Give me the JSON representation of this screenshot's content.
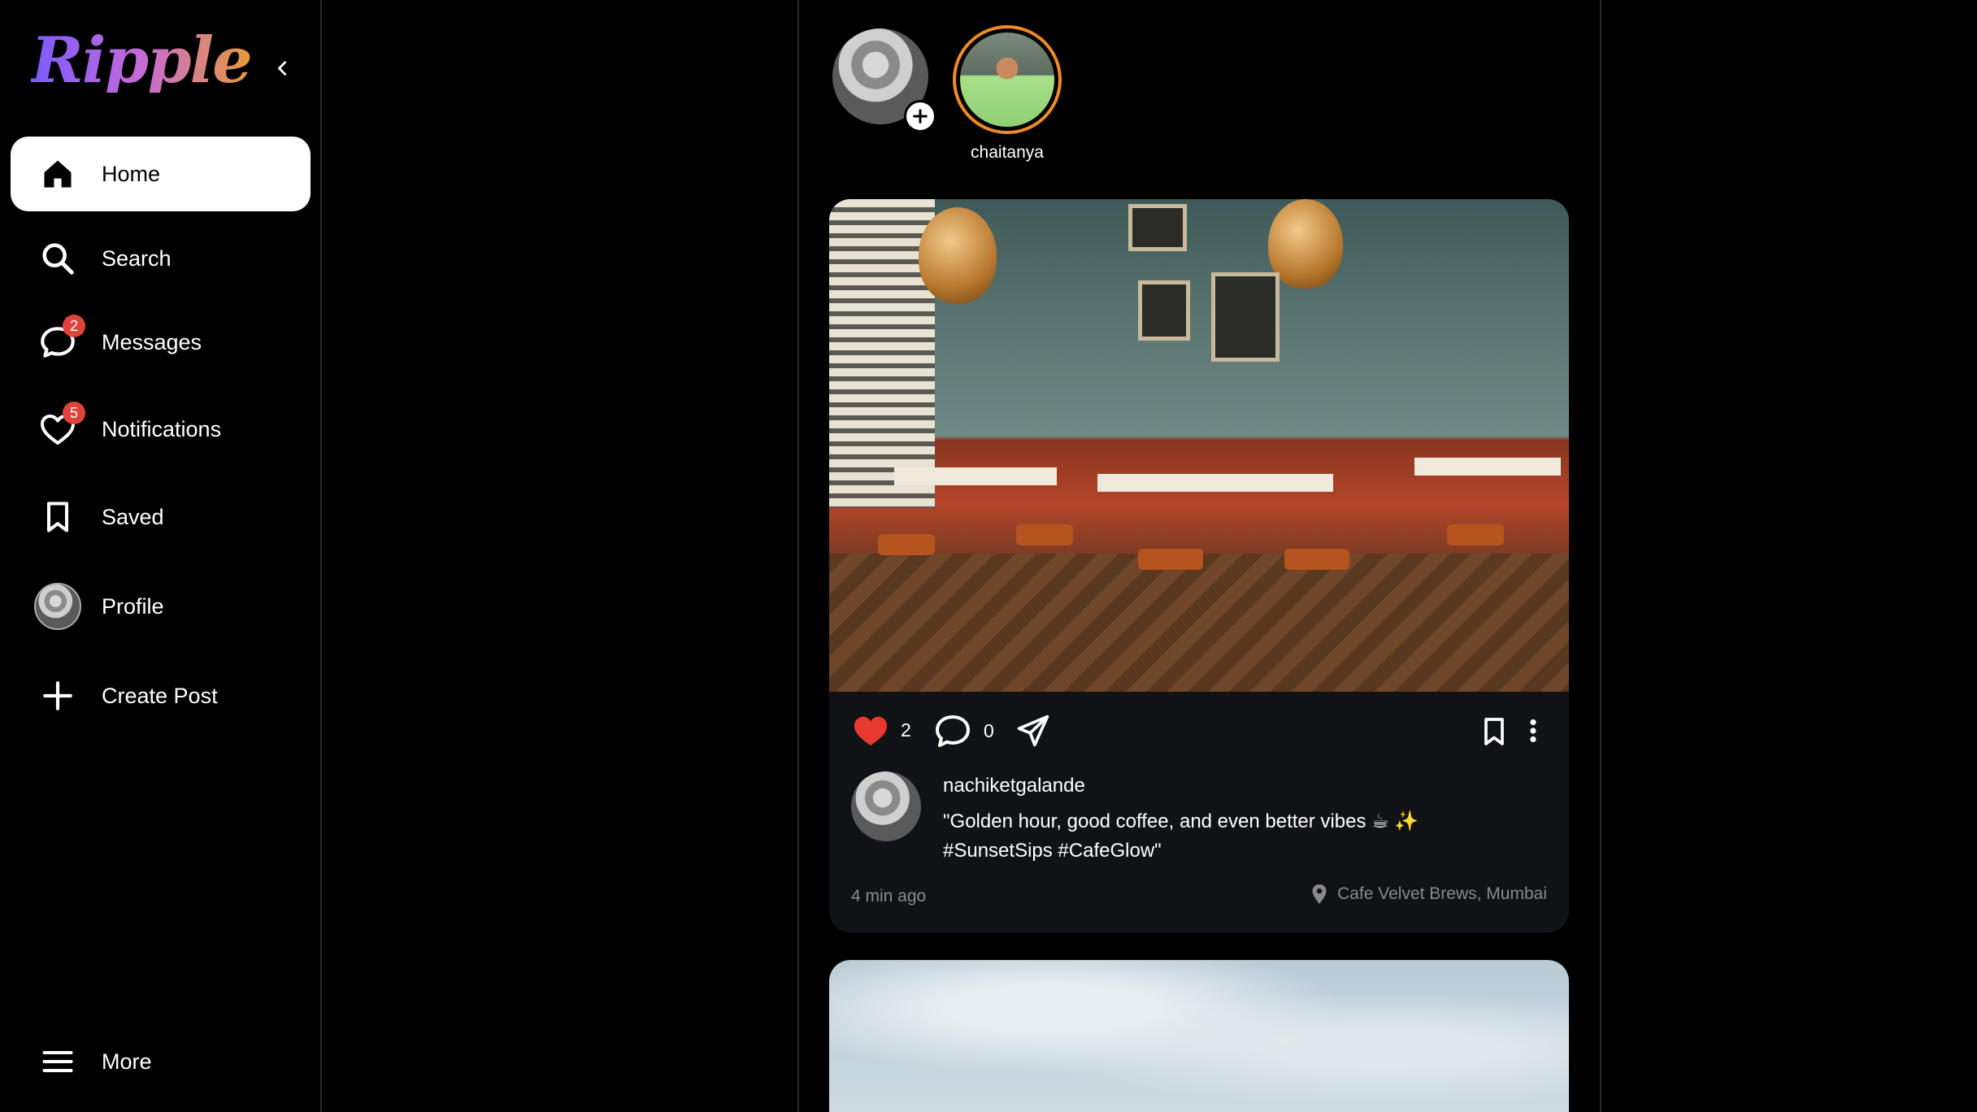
{
  "app": {
    "name": "Ripple"
  },
  "sidebar": {
    "items": [
      {
        "label": "Home",
        "icon": "home-icon",
        "active": true
      },
      {
        "label": "Search",
        "icon": "search-icon"
      },
      {
        "label": "Messages",
        "icon": "message-icon",
        "badge": "2"
      },
      {
        "label": "Notifications",
        "icon": "heart-icon",
        "badge": "5"
      },
      {
        "label": "Saved",
        "icon": "bookmark-icon"
      },
      {
        "label": "Profile",
        "icon": "avatar"
      },
      {
        "label": "Create Post",
        "icon": "plus-icon"
      }
    ],
    "more_label": "More"
  },
  "stories": [
    {
      "name": "chaitanya"
    }
  ],
  "post": {
    "likes": "2",
    "comments": "0",
    "author": "nachiketgalande",
    "caption_line1": "\"Golden hour, good coffee, and even better vibes ☕ ✨",
    "caption_line2": "#SunsetSips #CafeGlow\"",
    "time": "4 min ago",
    "location": "Cafe Velvet Brews, Mumbai"
  },
  "colors": {
    "accent_like": "#e8392f",
    "badge": "#e0433c",
    "story_ring": "#ef8a2a",
    "card_bg": "#111216"
  }
}
